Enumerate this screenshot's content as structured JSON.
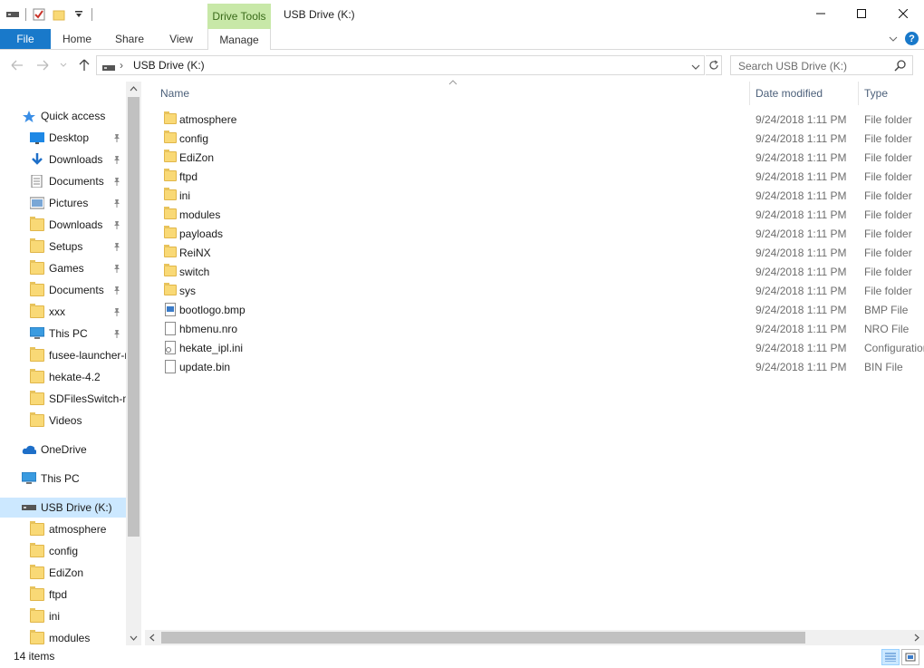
{
  "window": {
    "title": "USB Drive (K:)",
    "context_tab": "Drive Tools"
  },
  "ribbon": {
    "tabs": [
      {
        "label": "File"
      },
      {
        "label": "Home"
      },
      {
        "label": "Share"
      },
      {
        "label": "View"
      },
      {
        "label": "Manage"
      }
    ]
  },
  "address": {
    "path": "USB Drive (K:)",
    "search_placeholder": "Search USB Drive (K:)"
  },
  "sidebar": {
    "items": [
      {
        "label": "Quick access",
        "icon": "star-icon",
        "level": 0
      },
      {
        "label": "Desktop",
        "icon": "desktop-icon",
        "level": 1,
        "pinned": true
      },
      {
        "label": "Downloads",
        "icon": "download-icon",
        "level": 1,
        "pinned": true
      },
      {
        "label": "Documents",
        "icon": "documents-icon",
        "level": 1,
        "pinned": true
      },
      {
        "label": "Pictures",
        "icon": "pictures-icon",
        "level": 1,
        "pinned": true
      },
      {
        "label": "Downloads",
        "icon": "folder-icon",
        "level": 1,
        "pinned": true
      },
      {
        "label": "Setups",
        "icon": "folder-icon",
        "level": 1,
        "pinned": true
      },
      {
        "label": "Games",
        "icon": "folder-icon",
        "level": 1,
        "pinned": true
      },
      {
        "label": "Documents",
        "icon": "folder-icon",
        "level": 1,
        "pinned": true
      },
      {
        "label": "xxx",
        "icon": "folder-icon",
        "level": 1,
        "pinned": true
      },
      {
        "label": "This PC",
        "icon": "computer-icon",
        "level": 1,
        "pinned": true
      },
      {
        "label": "fusee-launcher-r",
        "icon": "folder-icon",
        "level": 1
      },
      {
        "label": "hekate-4.2",
        "icon": "folder-icon",
        "level": 1
      },
      {
        "label": "SDFilesSwitch-m",
        "icon": "folder-icon",
        "level": 1
      },
      {
        "label": "Videos",
        "icon": "folder-icon",
        "level": 1
      },
      {
        "label": "OneDrive",
        "icon": "cloud-icon",
        "level": 0
      },
      {
        "label": "This PC",
        "icon": "computer-icon",
        "level": 0
      },
      {
        "label": "USB Drive (K:)",
        "icon": "usb-drive-icon",
        "level": 0,
        "selected": true
      },
      {
        "label": "atmosphere",
        "icon": "folder-icon",
        "level": 1
      },
      {
        "label": "config",
        "icon": "folder-icon",
        "level": 1
      },
      {
        "label": "EdiZon",
        "icon": "folder-icon",
        "level": 1
      },
      {
        "label": "ftpd",
        "icon": "folder-icon",
        "level": 1
      },
      {
        "label": "ini",
        "icon": "folder-icon",
        "level": 1
      },
      {
        "label": "modules",
        "icon": "folder-icon",
        "level": 1
      }
    ]
  },
  "list": {
    "columns": [
      "Name",
      "Date modified",
      "Type"
    ],
    "files": [
      {
        "name": "atmosphere",
        "date": "9/24/2018 1:11 PM",
        "type": "File folder",
        "icon": "folder-icon"
      },
      {
        "name": "config",
        "date": "9/24/2018 1:11 PM",
        "type": "File folder",
        "icon": "folder-icon"
      },
      {
        "name": "EdiZon",
        "date": "9/24/2018 1:11 PM",
        "type": "File folder",
        "icon": "folder-icon"
      },
      {
        "name": "ftpd",
        "date": "9/24/2018 1:11 PM",
        "type": "File folder",
        "icon": "folder-icon"
      },
      {
        "name": "ini",
        "date": "9/24/2018 1:11 PM",
        "type": "File folder",
        "icon": "folder-icon"
      },
      {
        "name": "modules",
        "date": "9/24/2018 1:11 PM",
        "type": "File folder",
        "icon": "folder-icon"
      },
      {
        "name": "payloads",
        "date": "9/24/2018 1:11 PM",
        "type": "File folder",
        "icon": "folder-icon"
      },
      {
        "name": "ReiNX",
        "date": "9/24/2018 1:11 PM",
        "type": "File folder",
        "icon": "folder-icon"
      },
      {
        "name": "switch",
        "date": "9/24/2018 1:11 PM",
        "type": "File folder",
        "icon": "folder-icon"
      },
      {
        "name": "sys",
        "date": "9/24/2018 1:11 PM",
        "type": "File folder",
        "icon": "folder-icon"
      },
      {
        "name": "bootlogo.bmp",
        "date": "9/24/2018 1:11 PM",
        "type": "BMP File",
        "icon": "image-file-icon"
      },
      {
        "name": "hbmenu.nro",
        "date": "9/24/2018 1:11 PM",
        "type": "NRO File",
        "icon": "file-icon"
      },
      {
        "name": "hekate_ipl.ini",
        "date": "9/24/2018 1:11 PM",
        "type": "Configuration",
        "icon": "config-file-icon"
      },
      {
        "name": "update.bin",
        "date": "9/24/2018 1:11 PM",
        "type": "BIN File",
        "icon": "file-icon"
      }
    ]
  },
  "status": {
    "count": "14 items"
  }
}
